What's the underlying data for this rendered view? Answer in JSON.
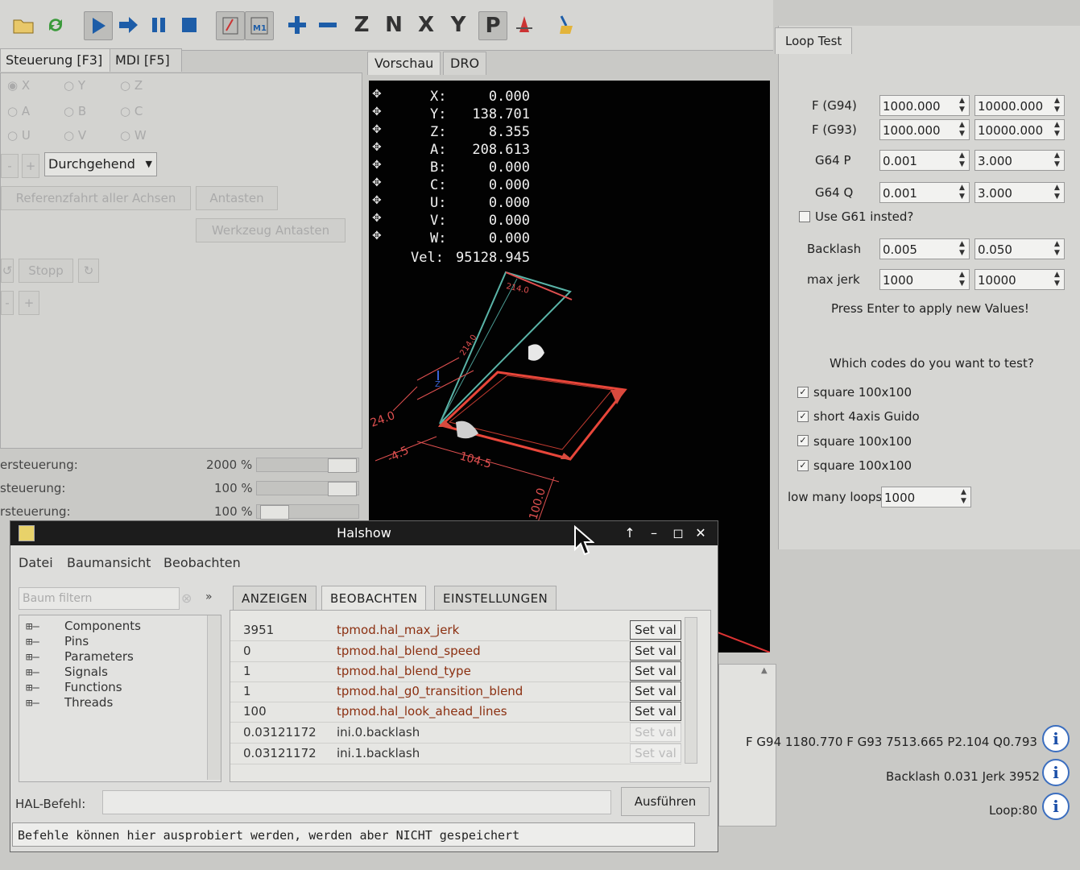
{
  "toolbar": {
    "icons": [
      "open-file-icon",
      "reload-icon",
      "run-icon",
      "step-icon",
      "pause-icon",
      "stop-icon",
      "block-delete-icon",
      "optional-stop-icon",
      "zoom-in-icon",
      "zoom-out-icon",
      "view-z-icon",
      "view-z2-icon",
      "view-x-icon",
      "view-y-icon",
      "view-p-icon",
      "rotate-icon",
      "clear-plot-icon"
    ],
    "labels": {
      "z": "Z",
      "z2": "N",
      "x": "X",
      "y": "Y",
      "p": "P"
    }
  },
  "left_tabs": [
    "Steuerung [F3]",
    "MDI [F5]"
  ],
  "axes_radio": [
    "X",
    "Y",
    "Z",
    "A",
    "B",
    "C",
    "U",
    "V",
    "W"
  ],
  "jog": {
    "minus": "-",
    "plus": "+",
    "mode": "Durchgehend"
  },
  "buttons": {
    "home_all": "Referenzfahrt aller Achsen",
    "touch_off": "Antasten",
    "tool_touch_off": "Werkzeug Antasten",
    "stop": "Stopp"
  },
  "overrides": [
    {
      "label": "ersteuerung:",
      "value": "2000 %",
      "level": 1.0
    },
    {
      "label": "steuerung:",
      "value": "100 %",
      "level": 1.0
    },
    {
      "label": "rsteuerung:",
      "value": "100 %",
      "level": 0.05
    }
  ],
  "preview_tabs": [
    "Vorschau",
    "DRO"
  ],
  "dro": [
    {
      "axis": "X:",
      "value": "0.000"
    },
    {
      "axis": "Y:",
      "value": "138.701"
    },
    {
      "axis": "Z:",
      "value": "8.355"
    },
    {
      "axis": "A:",
      "value": "208.613"
    },
    {
      "axis": "B:",
      "value": "0.000"
    },
    {
      "axis": "C:",
      "value": "0.000"
    },
    {
      "axis": "U:",
      "value": "0.000"
    },
    {
      "axis": "V:",
      "value": "0.000"
    },
    {
      "axis": "W:",
      "value": "0.000"
    }
  ],
  "velocity": {
    "label": "Vel:",
    "value": "95128.945"
  },
  "plot_labels": {
    "dim1": "104.5",
    "dim2": "-4.5",
    "dim3": "100.0",
    "dim4": "24.0",
    "dim5": "214.0",
    "dim6": "214.0",
    "axis_z": "Z"
  },
  "loop_test": {
    "tab": "Loop Test",
    "rows": [
      {
        "label": "F (G94)",
        "v1": "1000.000",
        "v2": "10000.000"
      },
      {
        "label": "F (G93)",
        "v1": "1000.000",
        "v2": "10000.000"
      },
      {
        "label": "G64 P",
        "v1": "0.001",
        "v2": "3.000"
      },
      {
        "label": "G64 Q",
        "v1": "0.001",
        "v2": "3.000"
      }
    ],
    "use_g61": "Use G61 insted?",
    "rows2": [
      {
        "label": "Backlash",
        "v1": "0.005",
        "v2": "0.050"
      },
      {
        "label": "max jerk",
        "v1": "1000",
        "v2": "10000"
      }
    ],
    "press_enter": "Press Enter to apply new Values!",
    "which_codes": "Which codes do you want to test?",
    "codes": [
      "square 100x100",
      "short 4axis Guido",
      "square 100x100",
      "square 100x100"
    ],
    "loops_label": "low many loops",
    "loops_value": "1000"
  },
  "status_lines": [
    "F G94 1180.770 F G93 7513.665 P2.104 Q0.793",
    "Backlash 0.031 Jerk 3952",
    "Loop:80"
  ],
  "halshow": {
    "title": "Halshow",
    "menu": [
      "Datei",
      "Baumansicht",
      "Beobachten"
    ],
    "filter_placeholder": "Baum filtern",
    "tree": [
      "Components",
      "Pins",
      "Parameters",
      "Signals",
      "Functions",
      "Threads"
    ],
    "tabs": [
      "ANZEIGEN",
      "BEOBACHTEN",
      "EINSTELLUNGEN"
    ],
    "watch": [
      {
        "value": "3951",
        "name": "tpmod.hal_max_jerk",
        "btn": "Set val",
        "enabled": true
      },
      {
        "value": "0",
        "name": "tpmod.hal_blend_speed",
        "btn": "Set val",
        "enabled": true
      },
      {
        "value": "1",
        "name": "tpmod.hal_blend_type",
        "btn": "Set val",
        "enabled": true
      },
      {
        "value": "1",
        "name": "tpmod.hal_g0_transition_blend",
        "btn": "Set val",
        "enabled": true
      },
      {
        "value": "100",
        "name": "tpmod.hal_look_ahead_lines",
        "btn": "Set val",
        "enabled": true
      },
      {
        "value": "0.03121172",
        "name": "ini.0.backlash",
        "btn": "Set val",
        "enabled": false
      },
      {
        "value": "0.03121172",
        "name": "ini.1.backlash",
        "btn": "Set val",
        "enabled": false
      }
    ],
    "hal_cmd_label": "HAL-Befehl:",
    "execute": "Ausführen",
    "message": "Befehle können hier ausprobiert werden, werden aber NICHT gespeichert"
  }
}
